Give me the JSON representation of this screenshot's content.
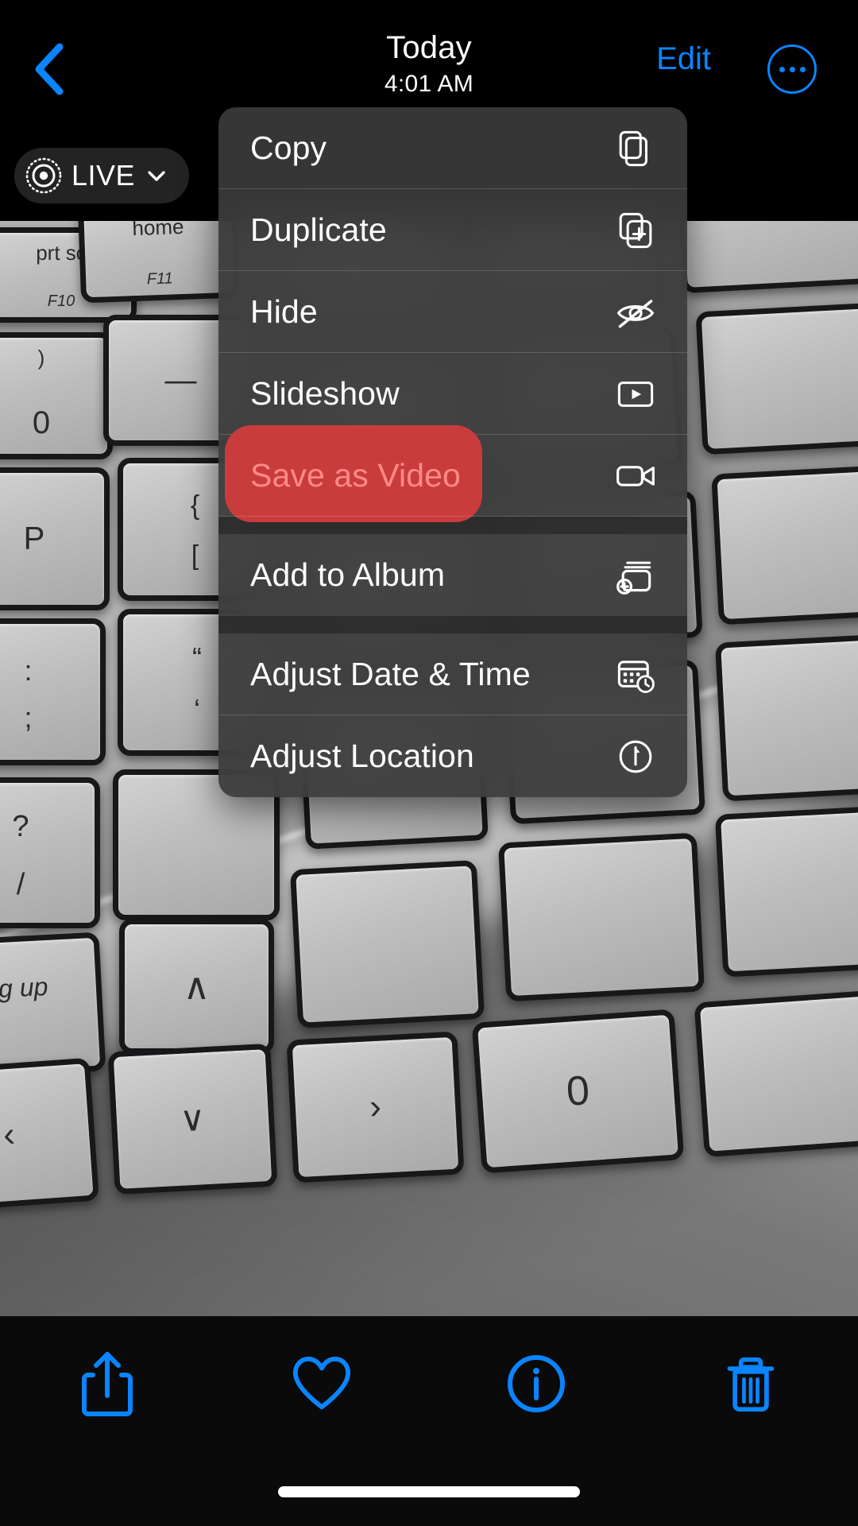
{
  "header": {
    "back_icon": "chevron-left-icon",
    "title": "Today",
    "subtitle": "4:01 AM",
    "edit_label": "Edit",
    "more_icon": "ellipsis-circle-icon",
    "accent_color": "#0a84ff"
  },
  "live_badge": {
    "icon": "live-photo-icon",
    "label": "LIVE",
    "chevron_icon": "chevron-down-icon"
  },
  "photo": {
    "description": "Close-up photo of a silver laptop keyboard",
    "keys": [
      {
        "top": "prt sc",
        "bottom": "F10"
      },
      {
        "top": "home",
        "bottom": "F11"
      },
      {
        "top": ")",
        "bottom": "0"
      },
      {
        "top": "—",
        "bottom": ""
      },
      {
        "top": "P",
        "bottom": ""
      },
      {
        "top": "{",
        "bottom": "["
      },
      {
        "top": ":",
        "bottom": ";"
      },
      {
        "top": "“",
        "bottom": "‘"
      },
      {
        "top": "?",
        "bottom": "/"
      },
      {
        "top": "pg up",
        "bottom": ""
      },
      {
        "top": "∧",
        "bottom": ""
      },
      {
        "top": "‹",
        "bottom": ""
      },
      {
        "top": "∨",
        "bottom": ""
      },
      {
        "top": "›",
        "bottom": ""
      },
      {
        "top": "0",
        "bottom": ""
      }
    ]
  },
  "context_menu": {
    "highlight_color": "#c93c3c",
    "highlight_text_color": "#ff8a85",
    "items": [
      {
        "label": "Copy",
        "icon": "copy-icon",
        "highlighted": false,
        "gap_after": false
      },
      {
        "label": "Duplicate",
        "icon": "duplicate-icon",
        "highlighted": false,
        "gap_after": false
      },
      {
        "label": "Hide",
        "icon": "eye-slash-icon",
        "highlighted": false,
        "gap_after": false
      },
      {
        "label": "Slideshow",
        "icon": "play-rectangle-icon",
        "highlighted": false,
        "gap_after": false
      },
      {
        "label": "Save as Video",
        "icon": "video-camera-icon",
        "highlighted": true,
        "gap_after": true
      },
      {
        "label": "Add to Album",
        "icon": "add-to-album-icon",
        "highlighted": false,
        "gap_after": true
      },
      {
        "label": "Adjust Date & Time",
        "icon": "calendar-clock-icon",
        "highlighted": false,
        "gap_after": false
      },
      {
        "label": "Adjust Location",
        "icon": "location-pin-icon",
        "highlighted": false,
        "gap_after": false
      }
    ]
  },
  "toolbar": {
    "accent_color": "#0a84ff",
    "buttons": [
      {
        "name": "share",
        "icon": "share-icon"
      },
      {
        "name": "favorite",
        "icon": "heart-icon"
      },
      {
        "name": "info",
        "icon": "info-circle-icon"
      },
      {
        "name": "delete",
        "icon": "trash-icon"
      }
    ]
  }
}
